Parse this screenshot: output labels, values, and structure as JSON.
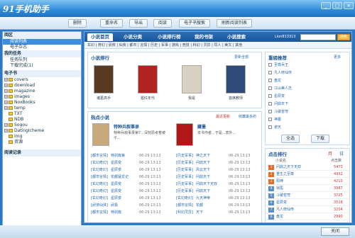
{
  "app": {
    "title": "91手机助手"
  },
  "toolbar": {
    "buttons": [
      "删除",
      "重命名",
      "导出",
      "阅读",
      "电子书搜索",
      "刷新阅读列表"
    ]
  },
  "sidebar": {
    "section1": "阅区",
    "items1": [
      "阅读列表",
      "电子杂志"
    ],
    "section2": "我的任务",
    "items2": [
      "任务队列",
      "下载完成(1)"
    ],
    "section3": "电子书",
    "tree": [
      "covers",
      "download",
      "magazine",
      "images",
      "NoxBooks",
      "temp",
      "TXT",
      "NDB",
      "Sogou",
      "DatingIcheme",
      "img",
      "资源"
    ],
    "footer": "阅读记录"
  },
  "main": {
    "tabs": [
      "小说首页",
      "小说分类",
      "小说排行榜",
      "我的书架",
      "小说搜索"
    ],
    "user": "Lion813313",
    "logout": "退出",
    "search_btn": "搜索",
    "subnav": "玄幻 | 奇幻 | 武侠 | 仙侠 | 都市 | 言情 | 历史 | 军事 | 游戏 | 竞技 | 科幻 | 灵异 | 同人 | 美文 | 其他",
    "recommend_title": "小说排行",
    "recommend_more": "更新全部",
    "top_books": [
      {
        "caption": "诸葛高手",
        "color": "#5a3a22"
      },
      {
        "caption": "猩红年代",
        "color": "#b22222"
      },
      {
        "caption": "我是",
        "color": "#d8d0c0"
      },
      {
        "caption": "首席教师",
        "color": "#2e4b7a"
      }
    ],
    "hot_title": "热点小说",
    "hot_tabs": [
      "最近更新",
      "收藏最多的"
    ],
    "hot_books": [
      {
        "title": "特种兵叙事录",
        "desc": "特种兵叙事录第7...深刻思考着被子...",
        "color": "#c9a97a"
      },
      {
        "title": "藏墨",
        "desc": "本书作者...于是...意外...",
        "color": "#b01818"
      }
    ],
    "list": [
      [
        "[都市言情]",
        "特别篇第",
        "06-29 13:13",
        "[历史军事]",
        "神之天下",
        "06-29 13:13"
      ],
      [
        "[玄幻奇幻]",
        "星辰变",
        "06-29 13:13",
        "[历史军事]",
        "问鼎天下",
        "06-29 13:13"
      ],
      [
        "[玄幻奇幻]",
        "星辰变",
        "06-29 13:13",
        "[历史军事]",
        "风云天下",
        "06-29 13:13"
      ],
      [
        "[都市言情]",
        "花都猛龙记",
        "06-29 13:13",
        "[历史军事]",
        "问鼎天下",
        "06-29 13:13"
      ],
      [
        "[玄幻奇幻]",
        "星辰变",
        "06-29 13:13",
        "[历史军事]",
        "问鼎天下无双",
        "06-29 13:13"
      ],
      [
        "[玄幻奇幻]",
        "星辰变",
        "06-29 13:13",
        "[历史军事]",
        "问鼎天下",
        "06-29 13:13"
      ],
      [
        "[玄幻奇幻]",
        "星辰变",
        "06-29 13:13",
        "[玄幻奇幻]",
        "九天神帝",
        "06-29 13:13"
      ],
      [
        "[武侠仙侠]",
        "武极",
        "06-29 13:13",
        "[都市言情]",
        "花都",
        "06-29 13:13"
      ],
      [
        "[都市言情]",
        "特别篇",
        "06-29 13:13",
        "[科幻灵异]",
        "天下",
        "06-29 13:13"
      ]
    ],
    "right_title": "重磅推荐",
    "right_more": "更多",
    "right_list": [
      "至尊兵王",
      "凡人修仙传",
      "盘龙",
      "江山美人志",
      "星辰变",
      "问鼎天下",
      "斗破苍穹",
      "神墓",
      "遮天"
    ],
    "right_btns": [
      "全选",
      "下载"
    ],
    "rank_title": "点击排行",
    "rank_tabs": [
      "月",
      "日"
    ],
    "rank_head": [
      "小说名",
      "点击数"
    ],
    "ranks": [
      {
        "name": "问鼎之天下无双",
        "count": "5473"
      },
      {
        "name": "重生之至尊",
        "count": "4932"
      },
      {
        "name": "阳神",
        "count": "4210"
      },
      {
        "name": "狱医",
        "count": "3987"
      },
      {
        "name": "斗破苍穹",
        "count": "3725"
      },
      {
        "name": "星辰变",
        "count": "3518"
      },
      {
        "name": "凡人修仙传",
        "count": "3204"
      },
      {
        "name": "盘龙",
        "count": "2990"
      }
    ]
  },
  "status": {
    "close": "关闭"
  }
}
